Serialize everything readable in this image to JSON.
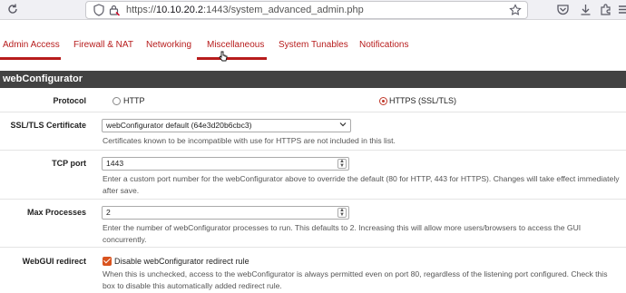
{
  "browser": {
    "url_prefix": "https://",
    "url_host": "10.10.20.2",
    "url_rest": ":1443/system_advanced_admin.php"
  },
  "tabs": [
    {
      "label": "Admin Access",
      "active": true
    },
    {
      "label": "Firewall & NAT",
      "active": false
    },
    {
      "label": "Networking",
      "active": false
    },
    {
      "label": "Miscellaneous",
      "active": true
    },
    {
      "label": "System Tunables",
      "active": false
    },
    {
      "label": "Notifications",
      "active": false
    }
  ],
  "section": {
    "title": "webConfigurator"
  },
  "protocol": {
    "label": "Protocol",
    "options": [
      {
        "label": "HTTP",
        "selected": false
      },
      {
        "label": "HTTPS (SSL/TLS)",
        "selected": true
      }
    ]
  },
  "certificate": {
    "label": "SSL/TLS Certificate",
    "value": "webConfigurator default (64e3d20b6cbc3)",
    "help": "Certificates known to be incompatible with use for HTTPS are not included in this list."
  },
  "tcp_port": {
    "label": "TCP port",
    "value": "1443",
    "help": "Enter a custom port number for the webConfigurator above to override the default (80 for HTTP, 443 for HTTPS). Changes will take effect immediately after save."
  },
  "max_processes": {
    "label": "Max Processes",
    "value": "2",
    "help": "Enter the number of webConfigurator processes to run. This defaults to 2. Increasing this will allow more users/browsers to access the GUI concurrently."
  },
  "redirect": {
    "label": "WebGUI redirect",
    "checkbox_label": "Disable webConfigurator redirect rule",
    "checked": true,
    "help": "When this is unchecked, access to the webConfigurator is always permitted even on port 80, regardless of the listening port configured. Check this box to disable this automatically added redirect rule."
  },
  "colors": {
    "accent": "#b71c1c",
    "header_bg": "#424242",
    "checkbox": "#d9531e"
  }
}
